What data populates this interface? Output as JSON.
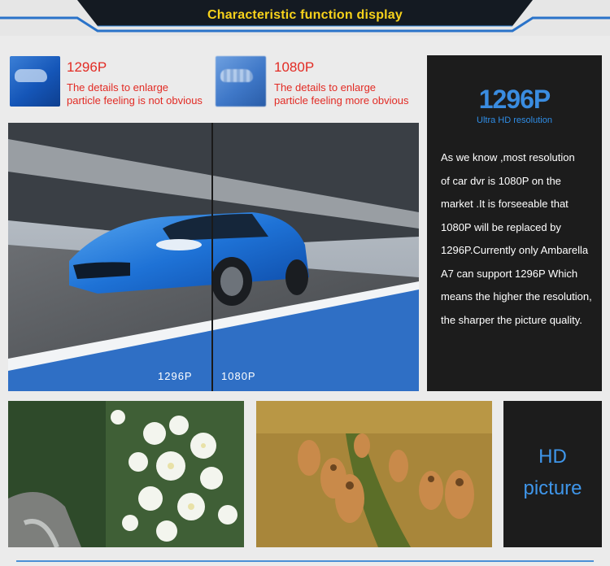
{
  "header": {
    "title": "Characteristic function display"
  },
  "comparison": {
    "left": {
      "label": "1296P",
      "desc_line1": "The details to enlarge",
      "desc_line2": "particle feeling is not obvious"
    },
    "right": {
      "label": "1080P",
      "desc_line1": "The details to enlarge",
      "desc_line2": "particle feeling more obvious"
    }
  },
  "car_image": {
    "left_caption": "1296P",
    "right_caption": "1080P"
  },
  "info": {
    "big": "1296P",
    "sub": "Ultra HD resolution",
    "lines": [
      "As we know ,most resolution",
      "of car dvr is 1080P on the",
      "market .It is forseeable that",
      "1080P will be replaced by",
      "1296P.Currently only Ambarella",
      "A7 can support 1296P Which",
      "means the higher the resolution,",
      "the sharper the picture quality."
    ]
  },
  "hd": {
    "line1": "HD",
    "line2": "picture"
  },
  "colors": {
    "accent_blue": "#3a8ce0",
    "title_yellow": "#f7d21b",
    "label_red": "#e22b24",
    "panel_dark": "#1c1c1c"
  }
}
